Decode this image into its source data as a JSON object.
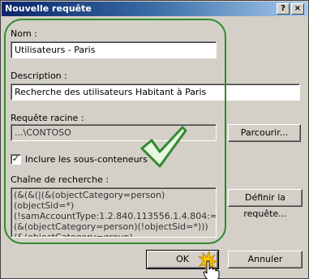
{
  "window": {
    "title": "Nouvelle requête",
    "help_label": "?",
    "close_label": "×"
  },
  "form": {
    "name_label": "Nom :",
    "name_value": "Utilisateurs - Paris",
    "description_label": "Description :",
    "description_value": "Recherche des utilisateurs Habitant à Paris",
    "root_label": "Requête racine :",
    "root_value": "...\\CONTOSO",
    "browse_label": "Parcourir...",
    "include_label": "Inclure les sous-conteneurs",
    "include_checked": true,
    "checkbox_mark": "✓",
    "search_label": "Chaîne de recherche :",
    "search_value": "(&(&(|(&(objectCategory=person)(objectSid=*)(!samAccountType:1.2.840.113556.1.4.804:=3))(&(objectCategory=person)(!objectSid=*)))(&(objectCategory=group)",
    "define_label": "Définir la requête..."
  },
  "footer": {
    "ok_label": "OK",
    "cancel_label": "Annuler"
  },
  "colors": {
    "annotation_green": "#2f8a2f",
    "title_start": "#0a246a",
    "title_end": "#a6caf0"
  },
  "icons": {
    "checkmark": "checkmark-icon",
    "cursor": "hand-cursor-icon"
  }
}
